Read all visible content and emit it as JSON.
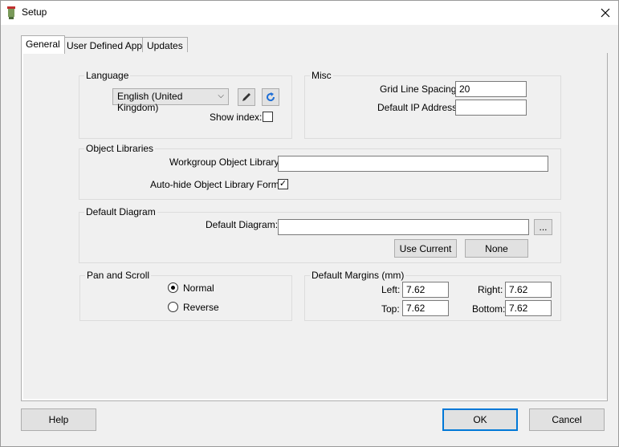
{
  "window": {
    "title": "Setup",
    "close_icon": "close-icon"
  },
  "tabs": [
    {
      "label": "General",
      "active": true
    },
    {
      "label": "User Defined Apps",
      "active": false
    },
    {
      "label": "Updates",
      "active": false
    }
  ],
  "language": {
    "group_title": "Language",
    "selected": "English (United Kingdom)",
    "edit_icon": "pencil-icon",
    "refresh_icon": "refresh-icon",
    "show_index_label": "Show index:",
    "show_index_checked": false
  },
  "misc": {
    "group_title": "Misc",
    "grid_line_spacing_label": "Grid Line Spacing:",
    "grid_line_spacing_value": "20",
    "default_ip_label": "Default IP Address:",
    "default_ip_value": ""
  },
  "object_libraries": {
    "group_title": "Object Libraries",
    "workgroup_label": "Workgroup Object Library:",
    "workgroup_value": "",
    "autohide_label": "Auto-hide Object Library Form:",
    "autohide_checked": true
  },
  "default_diagram": {
    "group_title": "Default Diagram",
    "label": "Default Diagram:",
    "value": "",
    "browse_label": "...",
    "use_current_label": "Use Current",
    "none_label": "None"
  },
  "pan_scroll": {
    "group_title": "Pan and Scroll",
    "options": [
      {
        "label": "Normal",
        "checked": true
      },
      {
        "label": "Reverse",
        "checked": false
      }
    ]
  },
  "margins": {
    "group_title": "Default Margins (mm)",
    "left_label": "Left:",
    "left_value": "7.62",
    "right_label": "Right:",
    "right_value": "7.62",
    "top_label": "Top:",
    "top_value": "7.62",
    "bottom_label": "Bottom:",
    "bottom_value": "7.62"
  },
  "footer": {
    "help_label": "Help",
    "ok_label": "OK",
    "cancel_label": "Cancel"
  },
  "colors": {
    "accent": "#0078d7",
    "window_bg": "#f0f0f0"
  }
}
